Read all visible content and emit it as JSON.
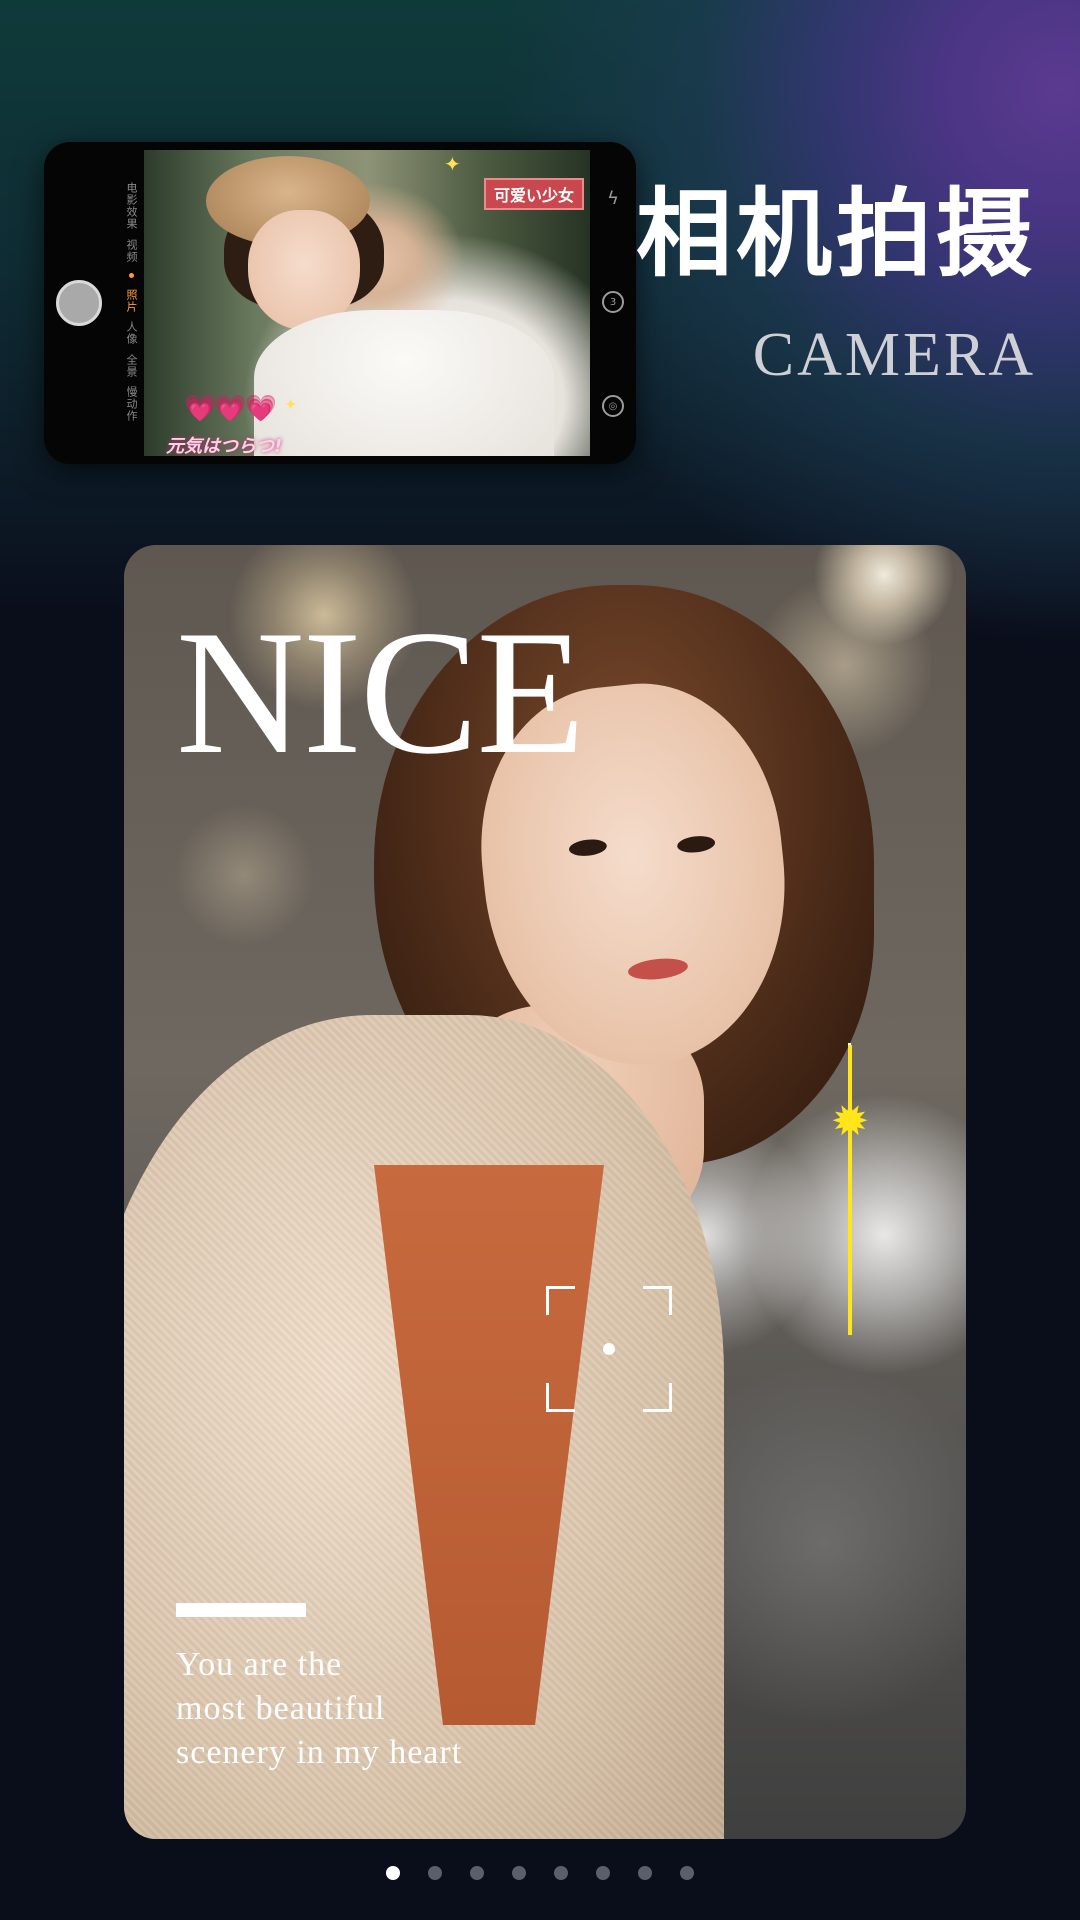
{
  "header": {
    "title_cn": "相机拍摄",
    "title_en": "CAMERA"
  },
  "phone": {
    "modes": [
      "电影效果",
      "视频",
      "照片",
      "人像",
      "全景",
      "慢动作"
    ],
    "active_mode": "照片",
    "sticker_top": "可爱い少女",
    "sticker_bottom": "元気はつらつ!",
    "hearts": "💗💗💗"
  },
  "card": {
    "headline": "NICE",
    "quote_lines": [
      "You are the",
      "most beautiful",
      "scenery in my heart"
    ]
  },
  "pagination": {
    "count": 8,
    "active_index": 0
  },
  "colors": {
    "exposure": "#ffe51a",
    "active_mode": "#ff9a3c"
  }
}
